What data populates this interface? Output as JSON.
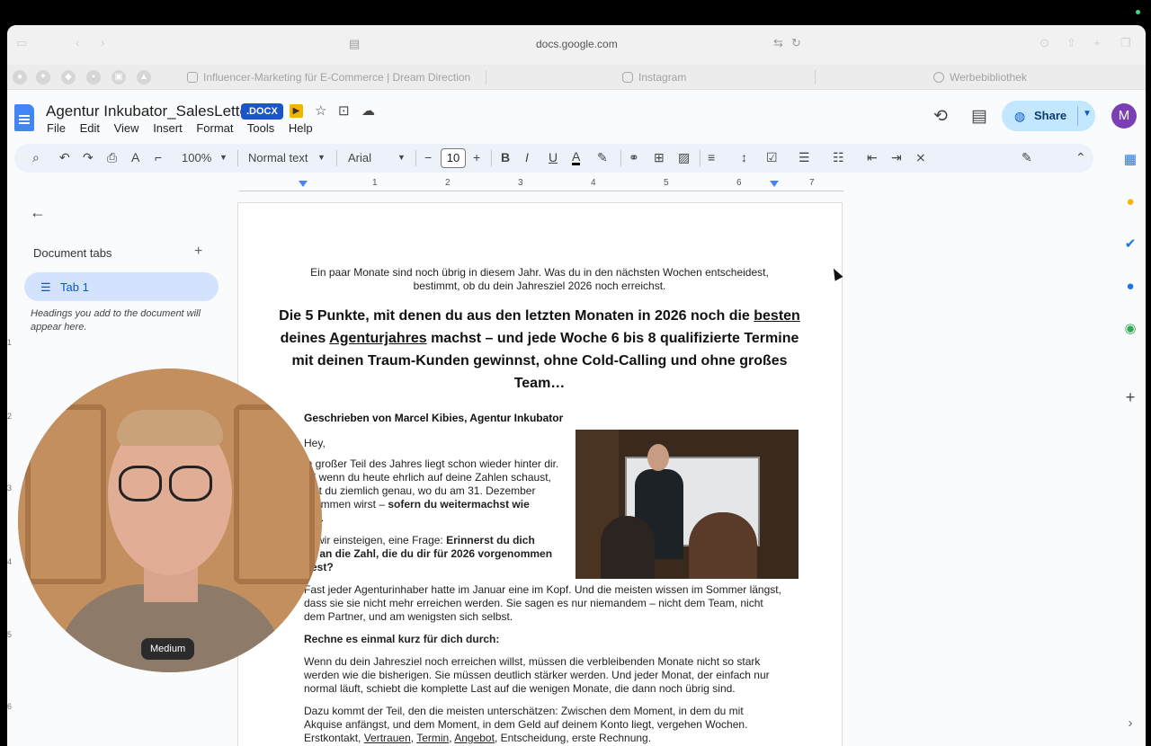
{
  "browser": {
    "url": "docs.google.com",
    "tabs": [
      {
        "title": "Influencer-Marketing für E-Commerce | Dream Direction"
      },
      {
        "title": "Instagram"
      },
      {
        "title": "Werbebibliothek"
      }
    ]
  },
  "docs": {
    "title": "Agentur Inkubator_SalesLetter",
    "format_badge": ".DOCX",
    "menu": [
      "File",
      "Edit",
      "View",
      "Insert",
      "Format",
      "Tools",
      "Help"
    ],
    "share_label": "Share",
    "avatar_initial": "M"
  },
  "toolbar": {
    "zoom": "100%",
    "style": "Normal text",
    "font": "Arial",
    "font_size": "10"
  },
  "ruler": {
    "numbers": [
      "1",
      "2",
      "3",
      "4",
      "5",
      "6",
      "7"
    ],
    "vertical_numbers": [
      "1",
      "2",
      "3",
      "4",
      "5",
      "6"
    ]
  },
  "outline": {
    "title": "Document tabs",
    "tab_label": "Tab 1",
    "hint": "Headings you add to the document will appear here."
  },
  "document": {
    "intro": "Ein paar Monate sind noch übrig in diesem Jahr. Was du in den nächsten Wochen entscheidest, bestimmt, ob du dein Jahresziel 2026 noch erreichst.",
    "headline_part1": "Die 5 Punkte, mit denen du aus den letzten Monaten in 2026 noch die ",
    "headline_u1": "besten",
    "headline_part2": " deines ",
    "headline_u2": "Agenturjahres",
    "headline_part3": " machst – und jede Woche 6 bis 8 qualifizierte Termine mit deinen Traum-Kunden gewinnst, ohne Cold-Calling und ohne großes Team…",
    "byline": "Geschrieben von Marcel Kibies, Agentur Inkubator",
    "greeting": "Hey,",
    "p1_lines": [
      "in großer Teil des Jahres liegt schon wieder hinter dir.",
      "nd wenn du heute ehrlich auf deine Zahlen schaust,",
      "eißt du ziemlich genau, wo du am 31. Dezember"
    ],
    "p1_end": "skommen wirst – ",
    "p1_bold1": "sofern du weitermachst wie",
    "p1_bold2": "her",
    "p1_dot": ".",
    "p2_start": "or wir einsteigen, eine Frage: ",
    "p2_bold1": "Erinnerst du dich",
    "p2_bold2": "ch an die Zahl, die du dir für 2026 vorgenommen",
    "p2_bold3": "ttest?",
    "p3_lines": [
      "Fast jeder Agenturinhaber hatte im Januar eine im Kopf. Und die meisten wissen im Sommer längst,",
      "dass sie sie nicht mehr erreichen werden. Sie sagen es nur niemandem – nicht dem Team, nicht",
      "dem Partner, und am wenigsten sich selbst."
    ],
    "subhead": "Rechne es einmal kurz für dich durch:",
    "p4_lines": [
      "Wenn du dein Jahresziel noch erreichen willst, müssen die verbleibenden Monate nicht so stark",
      "werden wie die bisherigen. Sie müssen deutlich stärker werden. Und jeder Monat, der einfach nur",
      "normal läuft, schiebt die komplette Last auf die wenigen Monate, die dann noch übrig sind."
    ],
    "p5_lines": [
      "Dazu kommt der Teil, den die meisten unterschätzen: Zwischen dem Moment, in dem du mit",
      "Akquise anfängst, und dem Moment, in dem Geld auf deinem Konto liegt, vergehen Wochen."
    ],
    "p5_last_a": "Erstkontakt, ",
    "p5_last_u1": "Vertrauen",
    "p5_last_b": ", ",
    "p5_last_u2": "Termin",
    "p5_last_c": ", ",
    "p5_last_u3": "Angebot",
    "p5_last_d": ", Entscheidung, erste Rechnung."
  },
  "webcam": {
    "label": "Medium"
  },
  "colors": {
    "accent": "#0b57d0",
    "share_bg": "#c2e7ff",
    "toolbar_bg": "#edf2fa"
  }
}
